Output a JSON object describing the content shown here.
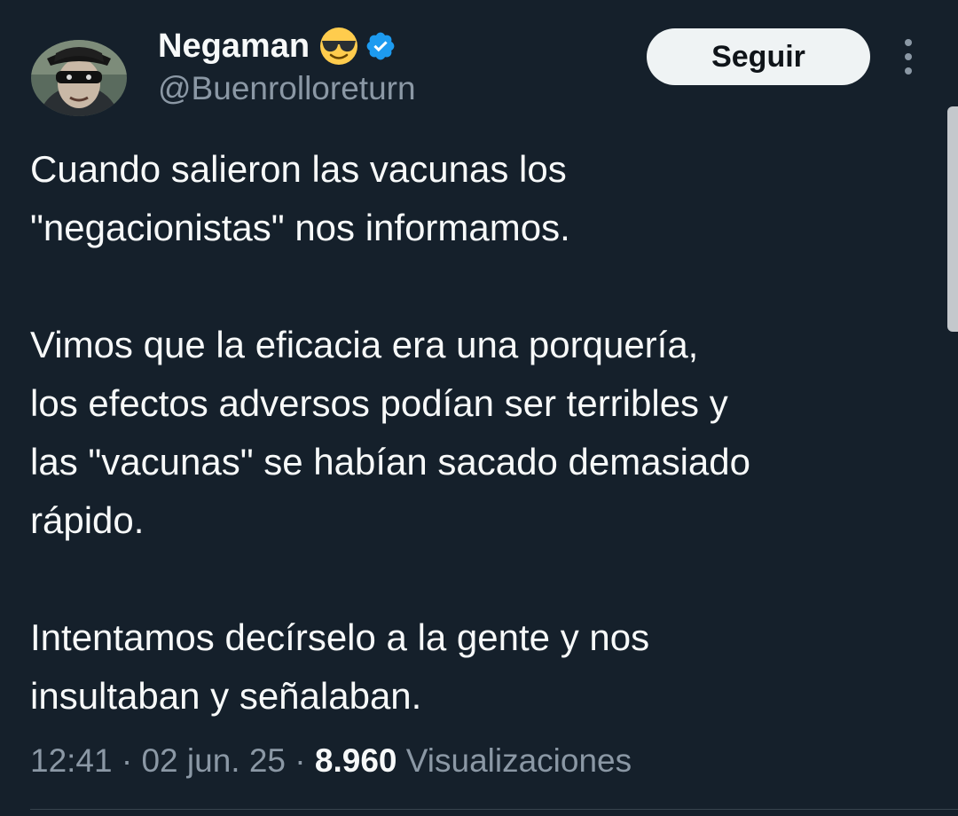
{
  "author": {
    "display_name": "Negaman",
    "handle": "@Buenrolloreturn",
    "emoji": "sunglasses-emoji",
    "verified_color": "#1d9bf0"
  },
  "actions": {
    "follow_label": "Seguir"
  },
  "tweet": {
    "paragraphs": [
      [
        "Cuando salieron las vacunas los",
        "\"negacionistas\" nos informamos."
      ],
      [
        "Vimos que la eficacia era una porquería,",
        "los efectos adversos podían ser terribles y",
        "las \"vacunas\" se habían sacado demasiado",
        "rápido."
      ],
      [
        "Intentamos decírselo a la gente y nos",
        "insultaban y señalaban."
      ]
    ]
  },
  "meta": {
    "time": "12:41",
    "separator": " · ",
    "date": "02 jun. 25",
    "views_count": "8.960",
    "views_label": "Visualizaciones"
  },
  "colors": {
    "background": "#15202b",
    "text": "#f7f9f9",
    "secondary": "#8b98a5",
    "button_bg": "#eff3f4"
  }
}
